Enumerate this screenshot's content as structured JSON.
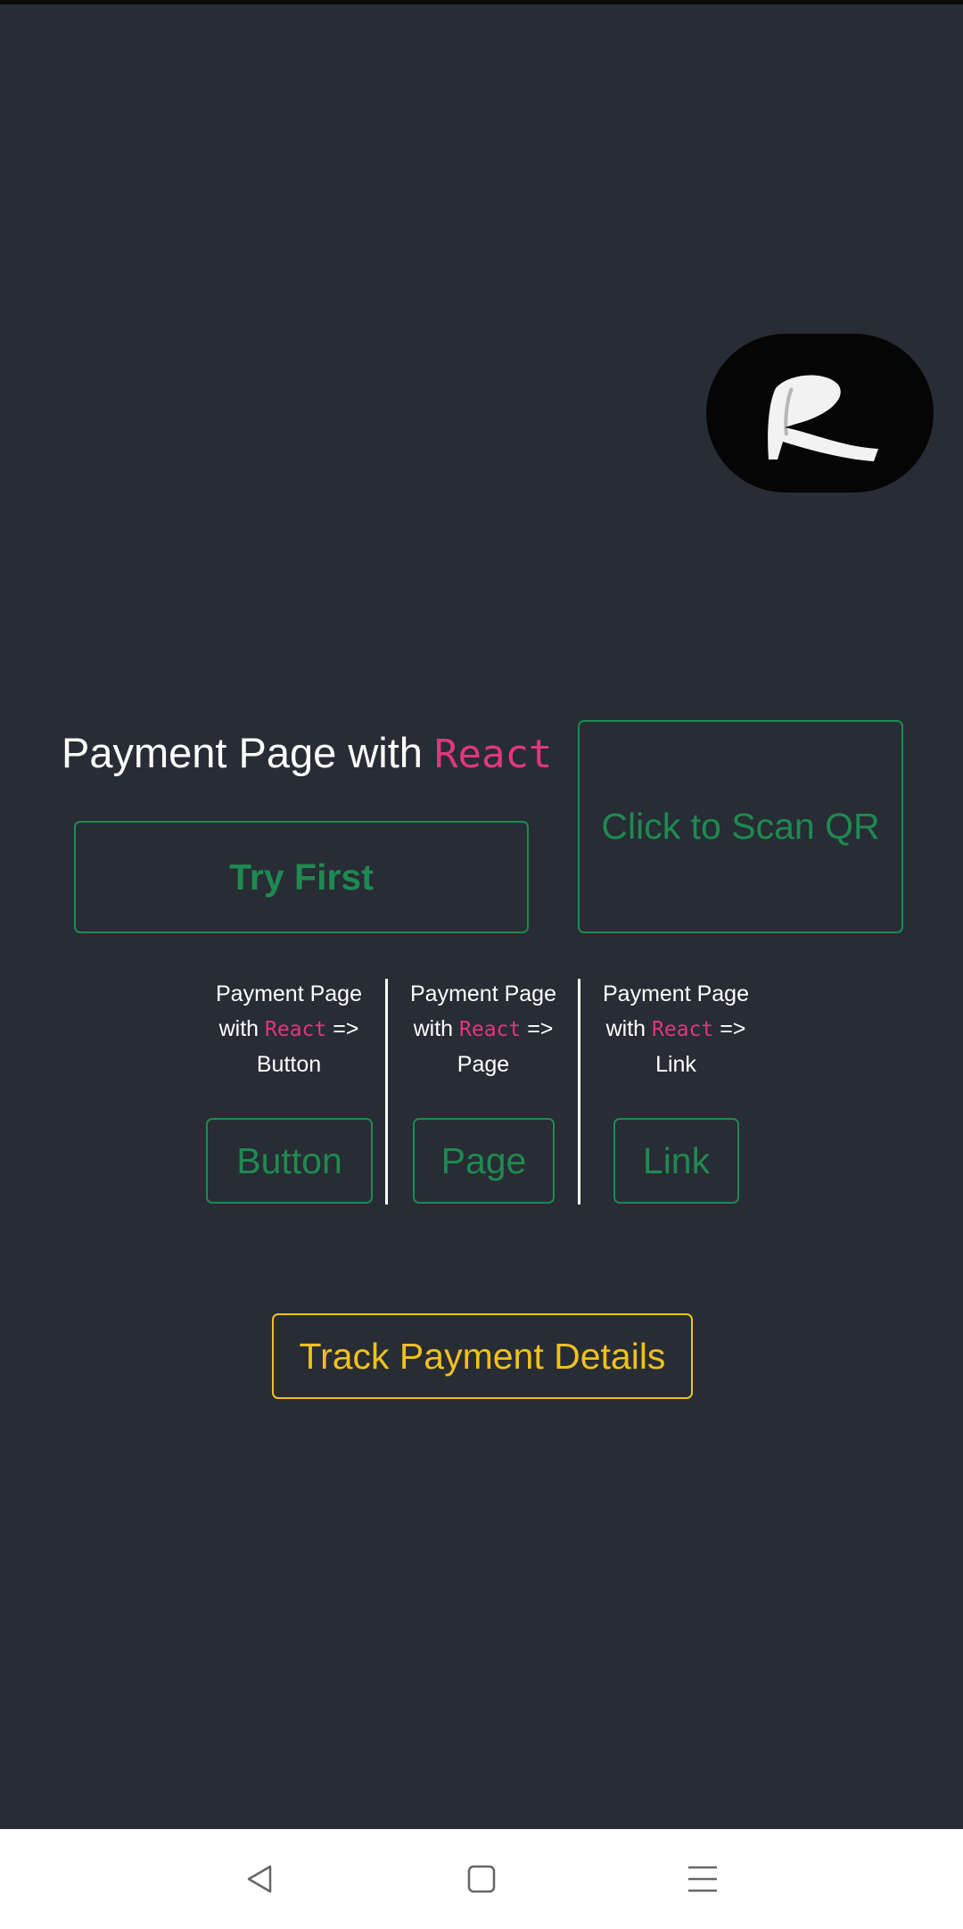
{
  "logo": {
    "icon": "rc-logo-icon",
    "letters": "RC"
  },
  "heading": {
    "prefix": "Payment Page with ",
    "code": "React"
  },
  "buttons": {
    "try_first": "Try First",
    "scan_qr": "Click to Scan QR",
    "track": "Track Payment Details"
  },
  "columns": [
    {
      "line1": "Payment Page",
      "with": "with ",
      "code": "React",
      "arrow": " =>",
      "kind": "Button",
      "button_label": "Button"
    },
    {
      "line1": "Payment Page",
      "with": "with ",
      "code": "React",
      "arrow": " =>",
      "kind": "Page",
      "button_label": "Page"
    },
    {
      "line1": "Payment Page",
      "with": "with ",
      "code": "React",
      "arrow": " =>",
      "kind": "Link",
      "button_label": "Link"
    }
  ],
  "navbar": {
    "icons": [
      "back-triangle-icon",
      "home-square-icon",
      "menu-lines-icon"
    ]
  },
  "colors": {
    "background": "#282c34",
    "accent_green": "#1e8a51",
    "accent_pink": "#e2377a",
    "accent_yellow": "#f0c01e"
  }
}
